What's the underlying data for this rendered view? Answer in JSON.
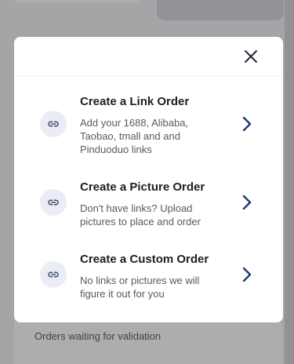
{
  "background": {
    "bottom_card_text": "Orders waiting for validation"
  },
  "modal": {
    "close_icon": "close-icon",
    "options": [
      {
        "icon": "link-icon",
        "title": "Create a Link Order",
        "description": "Add your 1688, Alibaba, Taobao, tmall and and Pinduoduo links",
        "chevron": "chevron-right-icon"
      },
      {
        "icon": "link-icon",
        "title": "Create a Picture Order",
        "description": "Don't have links? Upload pictures to place and order",
        "chevron": "chevron-right-icon"
      },
      {
        "icon": "link-icon",
        "title": "Create a Custom Order",
        "description": "No links or pictures we will figure it out for you",
        "chevron": "chevron-right-icon"
      }
    ]
  },
  "colors": {
    "accent": "#1f3a6e",
    "icon_bg": "#eaedf5",
    "overlay": "rgba(0,0,0,0.32)"
  }
}
